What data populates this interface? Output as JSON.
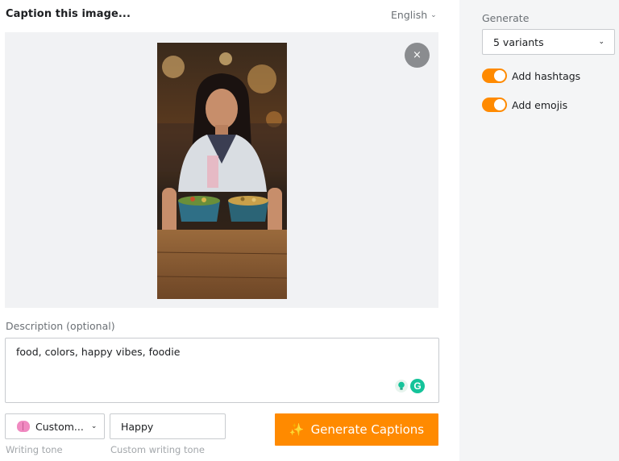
{
  "header": {
    "title": "Caption this image...",
    "language": "English"
  },
  "image": {
    "close_label": "×"
  },
  "description": {
    "label": "Description (optional)",
    "value": "food, colors, happy vibes, foodie"
  },
  "tone": {
    "select_value": "Custom...",
    "custom_value": "Happy",
    "select_label": "Writing tone",
    "custom_label": "Custom writing tone"
  },
  "generate_button": {
    "label": "Generate Captions",
    "icon": "sparkle-icon"
  },
  "sidebar": {
    "generate_label": "Generate",
    "variants_value": "5 variants",
    "toggles": [
      {
        "label": "Add hashtags",
        "on": true
      },
      {
        "label": "Add emojis",
        "on": true
      }
    ]
  },
  "colors": {
    "accent": "#ff8a00",
    "panel": "#f1f2f4",
    "sidebar": "#f4f5f6"
  }
}
